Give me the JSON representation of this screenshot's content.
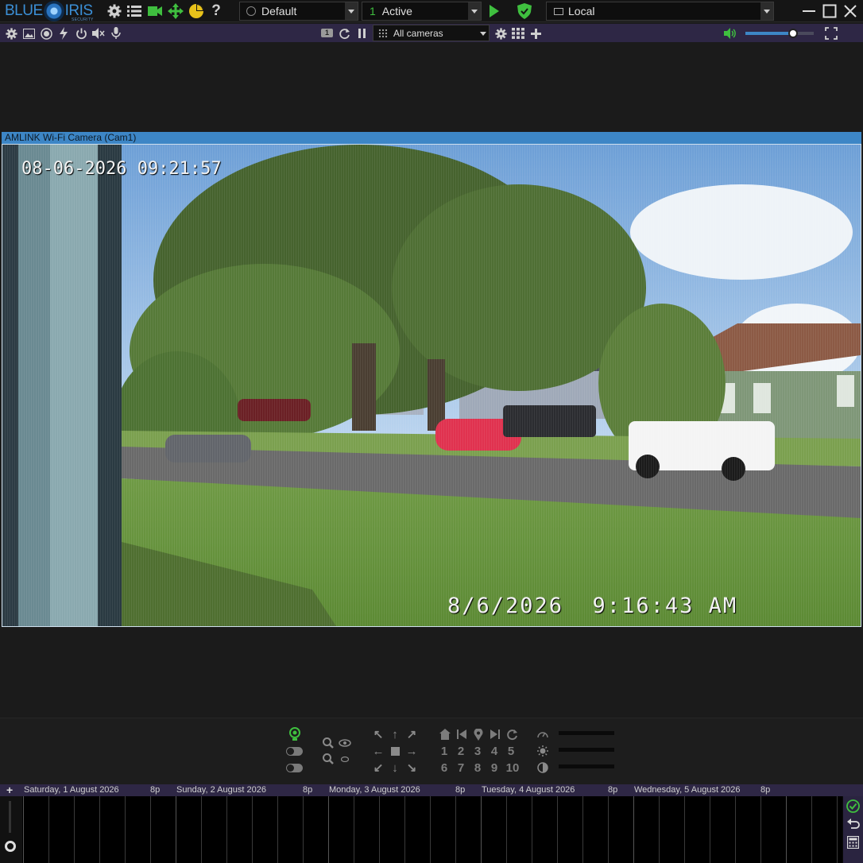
{
  "app": {
    "logo_left": "BLUE",
    "logo_right": "IRIS",
    "logo_sub": "SECURITY"
  },
  "toolbar": {
    "profile_dropdown": "Default",
    "schedule_number": "1",
    "schedule_dropdown": "Active",
    "connection_dropdown": "Local",
    "help_label": "?"
  },
  "subbar": {
    "group_badge": "1",
    "camera_group": "All cameras",
    "volume_level": 0.7
  },
  "camera": {
    "title": "AMLINK Wi-Fi Camera (Cam1)",
    "osd_top": "08-06-2026 09:21:57",
    "osd_bottom": "8/6/2026  9:16:43 AM"
  },
  "ptz": {
    "presets": [
      "1",
      "2",
      "3",
      "4",
      "5",
      "6",
      "7",
      "8",
      "9",
      "10"
    ]
  },
  "timeline": {
    "days": [
      {
        "label": "Saturday, 1 August 2026",
        "marker": "8p"
      },
      {
        "label": "Sunday, 2 August 2026",
        "marker": "8p"
      },
      {
        "label": "Monday, 3 August 2026",
        "marker": "8p"
      },
      {
        "label": "Tuesday, 4 August 2026",
        "marker": "8p"
      },
      {
        "label": "Wednesday, 5 August 2026",
        "marker": "8p"
      }
    ],
    "add_label": "+"
  },
  "colors": {
    "accent": "#3d86c6",
    "subbar": "#2e2745",
    "green": "#3fbf3f"
  }
}
